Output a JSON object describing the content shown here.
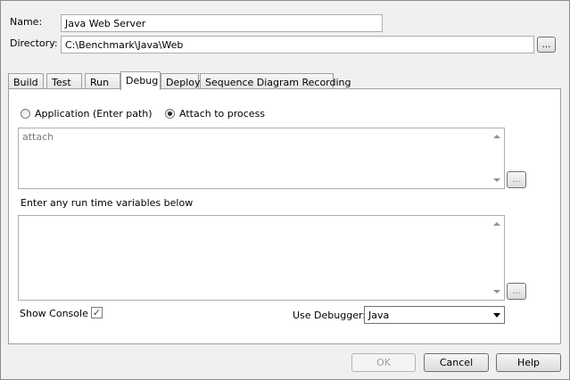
{
  "form": {
    "name_label": "Name:",
    "name_value": "Java Web Server",
    "directory_label": "Directory:",
    "directory_value": "C:\\Benchmark\\Java\\Web",
    "browse_label": "..."
  },
  "tabs": [
    {
      "label": "Build"
    },
    {
      "label": "Test"
    },
    {
      "label": "Run"
    },
    {
      "label": "Debug",
      "active": true
    },
    {
      "label": "Deploy"
    },
    {
      "label": "Sequence Diagram Recording"
    }
  ],
  "debug": {
    "radio_application_label": "Application (Enter path)",
    "radio_attach_label": "Attach to process",
    "selected_radio": "attach",
    "path_text": "attach",
    "path_browse_label": "...",
    "runtime_vars_label": "Enter any run time variables below",
    "runtime_vars_text": "",
    "vars_browse_label": "...",
    "show_console_label": "Show Console",
    "show_console_checked": true,
    "use_debugger_label": "Use Debugger:",
    "debugger_value": "Java"
  },
  "footer": {
    "ok_label": "OK",
    "cancel_label": "Cancel",
    "help_label": "Help"
  }
}
